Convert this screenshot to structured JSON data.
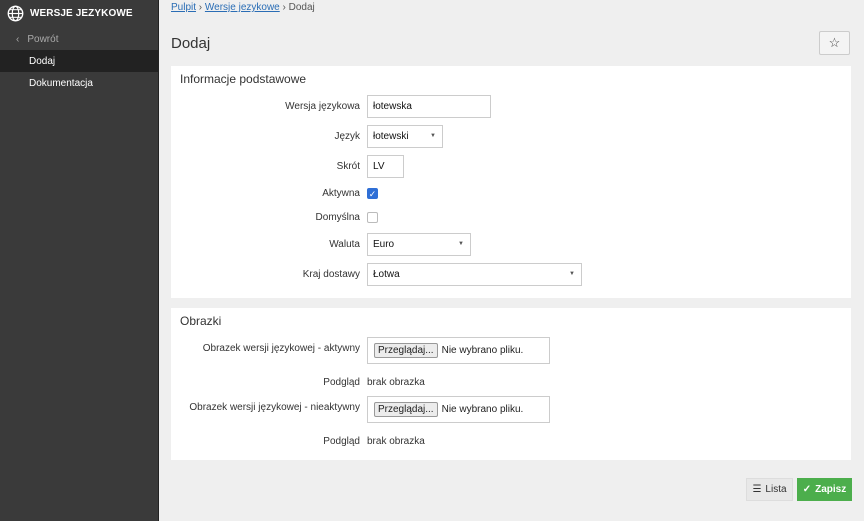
{
  "sidebar": {
    "app_title": "WERSJE JEZYKOWE",
    "back_label": "Powrót",
    "items": [
      {
        "label": "Dodaj",
        "active": true
      },
      {
        "label": "Dokumentacja",
        "active": false
      }
    ]
  },
  "breadcrumb": {
    "items": [
      "Pulpit",
      "Wersje jezykowe"
    ],
    "current": "Dodaj"
  },
  "page": {
    "title": "Dodaj"
  },
  "basic_info": {
    "title": "Informacje podstawowe",
    "language_version": {
      "label": "Wersja językowa",
      "value": "łotewska"
    },
    "language": {
      "label": "Język",
      "value": "łotewski"
    },
    "short": {
      "label": "Skrót",
      "value": "LV"
    },
    "active": {
      "label": "Aktywna",
      "checked": true
    },
    "default": {
      "label": "Domyślna",
      "checked": false
    },
    "currency": {
      "label": "Waluta",
      "value": "Euro"
    },
    "country": {
      "label": "Kraj dostawy",
      "value": "Łotwa"
    }
  },
  "images": {
    "title": "Obrazki",
    "active_image": {
      "label": "Obrazek wersji językowej - aktywny",
      "button": "Przeglądaj...",
      "status": "Nie wybrano pliku."
    },
    "active_preview": {
      "label": "Podgląd",
      "value": "brak obrazka"
    },
    "inactive_image": {
      "label": "Obrazek wersji językowej - nieaktywny",
      "button": "Przeglądaj...",
      "status": "Nie wybrano pliku."
    },
    "inactive_preview": {
      "label": "Podgląd",
      "value": "brak obrazka"
    }
  },
  "actions": {
    "list_label": "Lista",
    "save_label": "Zapisz"
  },
  "colors": {
    "sidebar": "#3a3a3a",
    "active_item": "#222222",
    "link": "#2a6db5",
    "save": "#4cae4c",
    "checkbox": "#2f6fd6"
  }
}
